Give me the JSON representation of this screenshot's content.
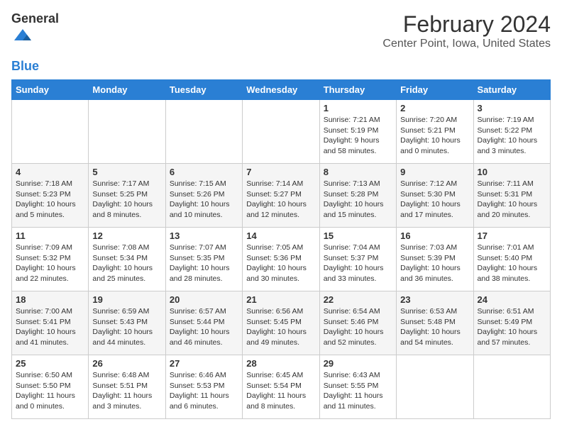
{
  "header": {
    "logo_general": "General",
    "logo_blue": "Blue",
    "month": "February 2024",
    "location": "Center Point, Iowa, United States"
  },
  "days_of_week": [
    "Sunday",
    "Monday",
    "Tuesday",
    "Wednesday",
    "Thursday",
    "Friday",
    "Saturday"
  ],
  "weeks": [
    [
      {
        "day": "",
        "info": ""
      },
      {
        "day": "",
        "info": ""
      },
      {
        "day": "",
        "info": ""
      },
      {
        "day": "",
        "info": ""
      },
      {
        "day": "1",
        "info": "Sunrise: 7:21 AM\nSunset: 5:19 PM\nDaylight: 9 hours\nand 58 minutes."
      },
      {
        "day": "2",
        "info": "Sunrise: 7:20 AM\nSunset: 5:21 PM\nDaylight: 10 hours\nand 0 minutes."
      },
      {
        "day": "3",
        "info": "Sunrise: 7:19 AM\nSunset: 5:22 PM\nDaylight: 10 hours\nand 3 minutes."
      }
    ],
    [
      {
        "day": "4",
        "info": "Sunrise: 7:18 AM\nSunset: 5:23 PM\nDaylight: 10 hours\nand 5 minutes."
      },
      {
        "day": "5",
        "info": "Sunrise: 7:17 AM\nSunset: 5:25 PM\nDaylight: 10 hours\nand 8 minutes."
      },
      {
        "day": "6",
        "info": "Sunrise: 7:15 AM\nSunset: 5:26 PM\nDaylight: 10 hours\nand 10 minutes."
      },
      {
        "day": "7",
        "info": "Sunrise: 7:14 AM\nSunset: 5:27 PM\nDaylight: 10 hours\nand 12 minutes."
      },
      {
        "day": "8",
        "info": "Sunrise: 7:13 AM\nSunset: 5:28 PM\nDaylight: 10 hours\nand 15 minutes."
      },
      {
        "day": "9",
        "info": "Sunrise: 7:12 AM\nSunset: 5:30 PM\nDaylight: 10 hours\nand 17 minutes."
      },
      {
        "day": "10",
        "info": "Sunrise: 7:11 AM\nSunset: 5:31 PM\nDaylight: 10 hours\nand 20 minutes."
      }
    ],
    [
      {
        "day": "11",
        "info": "Sunrise: 7:09 AM\nSunset: 5:32 PM\nDaylight: 10 hours\nand 22 minutes."
      },
      {
        "day": "12",
        "info": "Sunrise: 7:08 AM\nSunset: 5:34 PM\nDaylight: 10 hours\nand 25 minutes."
      },
      {
        "day": "13",
        "info": "Sunrise: 7:07 AM\nSunset: 5:35 PM\nDaylight: 10 hours\nand 28 minutes."
      },
      {
        "day": "14",
        "info": "Sunrise: 7:05 AM\nSunset: 5:36 PM\nDaylight: 10 hours\nand 30 minutes."
      },
      {
        "day": "15",
        "info": "Sunrise: 7:04 AM\nSunset: 5:37 PM\nDaylight: 10 hours\nand 33 minutes."
      },
      {
        "day": "16",
        "info": "Sunrise: 7:03 AM\nSunset: 5:39 PM\nDaylight: 10 hours\nand 36 minutes."
      },
      {
        "day": "17",
        "info": "Sunrise: 7:01 AM\nSunset: 5:40 PM\nDaylight: 10 hours\nand 38 minutes."
      }
    ],
    [
      {
        "day": "18",
        "info": "Sunrise: 7:00 AM\nSunset: 5:41 PM\nDaylight: 10 hours\nand 41 minutes."
      },
      {
        "day": "19",
        "info": "Sunrise: 6:59 AM\nSunset: 5:43 PM\nDaylight: 10 hours\nand 44 minutes."
      },
      {
        "day": "20",
        "info": "Sunrise: 6:57 AM\nSunset: 5:44 PM\nDaylight: 10 hours\nand 46 minutes."
      },
      {
        "day": "21",
        "info": "Sunrise: 6:56 AM\nSunset: 5:45 PM\nDaylight: 10 hours\nand 49 minutes."
      },
      {
        "day": "22",
        "info": "Sunrise: 6:54 AM\nSunset: 5:46 PM\nDaylight: 10 hours\nand 52 minutes."
      },
      {
        "day": "23",
        "info": "Sunrise: 6:53 AM\nSunset: 5:48 PM\nDaylight: 10 hours\nand 54 minutes."
      },
      {
        "day": "24",
        "info": "Sunrise: 6:51 AM\nSunset: 5:49 PM\nDaylight: 10 hours\nand 57 minutes."
      }
    ],
    [
      {
        "day": "25",
        "info": "Sunrise: 6:50 AM\nSunset: 5:50 PM\nDaylight: 11 hours\nand 0 minutes."
      },
      {
        "day": "26",
        "info": "Sunrise: 6:48 AM\nSunset: 5:51 PM\nDaylight: 11 hours\nand 3 minutes."
      },
      {
        "day": "27",
        "info": "Sunrise: 6:46 AM\nSunset: 5:53 PM\nDaylight: 11 hours\nand 6 minutes."
      },
      {
        "day": "28",
        "info": "Sunrise: 6:45 AM\nSunset: 5:54 PM\nDaylight: 11 hours\nand 8 minutes."
      },
      {
        "day": "29",
        "info": "Sunrise: 6:43 AM\nSunset: 5:55 PM\nDaylight: 11 hours\nand 11 minutes."
      },
      {
        "day": "",
        "info": ""
      },
      {
        "day": "",
        "info": ""
      }
    ]
  ]
}
